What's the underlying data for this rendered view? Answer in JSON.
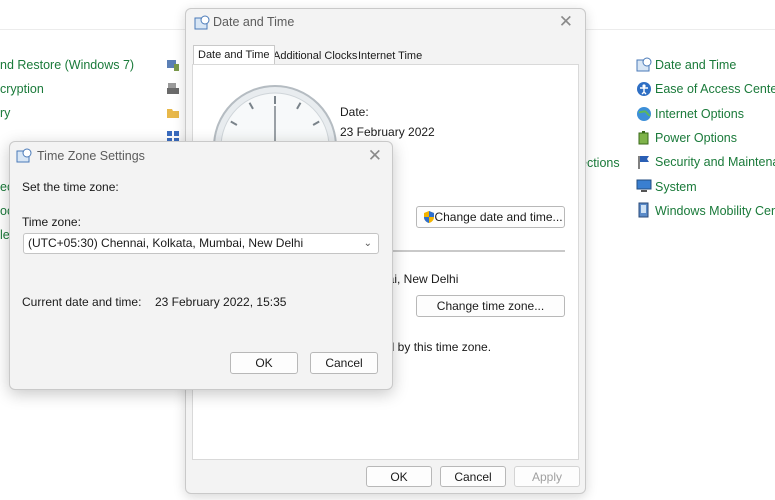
{
  "background_panel": {
    "left_links": [
      "nd Restore (Windows 7)",
      "cryption",
      "ry",
      "ec",
      "oc",
      "le"
    ],
    "middle_partial": "ections",
    "right_links": [
      {
        "label": "Date and Time",
        "icon": "clock-calendar-icon"
      },
      {
        "label": "Ease of Access Center",
        "icon": "accessibility-icon"
      },
      {
        "label": "Internet Options",
        "icon": "globe-icon"
      },
      {
        "label": "Power Options",
        "icon": "battery-icon"
      },
      {
        "label": "Security and Maintenan",
        "icon": "flag-icon"
      },
      {
        "label": "System",
        "icon": "computer-icon"
      },
      {
        "label": "Windows Mobility Cent",
        "icon": "mobility-icon"
      }
    ],
    "link_color": "#1a7a3a"
  },
  "date_time_dialog": {
    "title": "Date and Time",
    "tabs": [
      "Date and Time",
      "Additional Clocks",
      "Internet Time"
    ],
    "active_tab": "Date and Time",
    "date_label": "Date:",
    "date_value": "23 February 2022",
    "change_datetime_button": "Change date and time...",
    "timezone_partial": "bai, New Delhi",
    "change_timezone_button": "Change time zone...",
    "dst_partial": "ed by this time zone.",
    "ok_button": "OK",
    "cancel_button": "Cancel",
    "apply_button": "Apply"
  },
  "timezone_dialog": {
    "title": "Time Zone Settings",
    "instruction": "Set the time zone:",
    "timezone_label": "Time zone:",
    "timezone_value": "(UTC+05:30) Chennai, Kolkata, Mumbai, New Delhi",
    "current_label": "Current date and time:",
    "current_value": "23 February 2022, 15:35",
    "ok_button": "OK",
    "cancel_button": "Cancel"
  }
}
